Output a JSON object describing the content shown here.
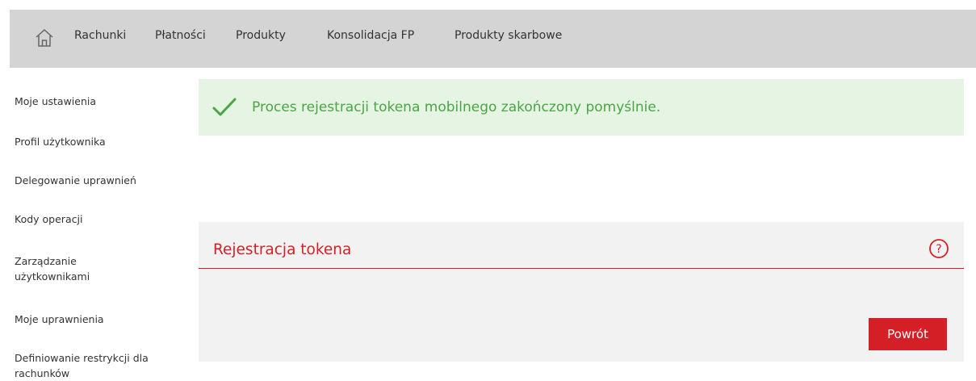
{
  "nav": {
    "home_icon": "home-icon",
    "items": [
      "Rachunki",
      "Płatności",
      "Produkty",
      "Konsolidacja FP",
      "Produkty skarbowe"
    ]
  },
  "sidebar": {
    "items": [
      "Moje ustawienia",
      "Profil użytkownika",
      "Delegowanie uprawnień",
      "Kody operacji",
      "Zarządzanie użytkownikami",
      "Moje uprawnienia",
      "Definiowanie restrykcji dla rachunków"
    ]
  },
  "alert": {
    "icon": "checkmark-icon",
    "message": "Proces rejestracji tokena mobilnego zakończony pomyślnie.",
    "color": "#4aa644"
  },
  "panel": {
    "title": "Rejestracja tokena",
    "help_icon": "help-icon",
    "back_label": "Powrót"
  },
  "colors": {
    "accent": "#d51f26",
    "success": "#4aa644",
    "nav_bg": "#d4d4d4"
  }
}
